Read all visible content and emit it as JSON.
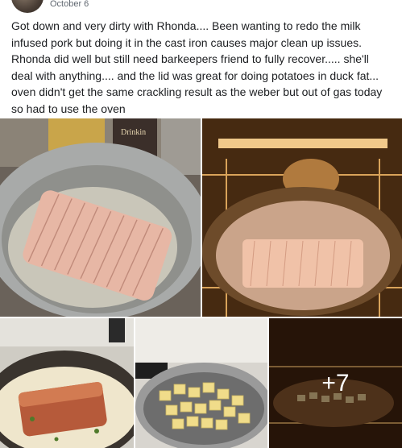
{
  "post": {
    "date": "October 6",
    "text": "Got down and very dirty with Rhonda.... Been wanting to redo the milk infused pork but doing it in the cast iron causes major clean up issues. Rhonda did well but still need barkeepers friend to fully recover..... she'll deal with anything.... and the lid was great for doing potatoes in duck fat... oven didn't get the same crackling result as the weber but out of gas today so had to use the oven"
  },
  "photos": {
    "more_count": "+7",
    "items": [
      {
        "id": "photo-1",
        "label": "Drinkin"
      },
      {
        "id": "photo-2"
      },
      {
        "id": "photo-3"
      },
      {
        "id": "photo-4"
      },
      {
        "id": "photo-5"
      }
    ]
  }
}
